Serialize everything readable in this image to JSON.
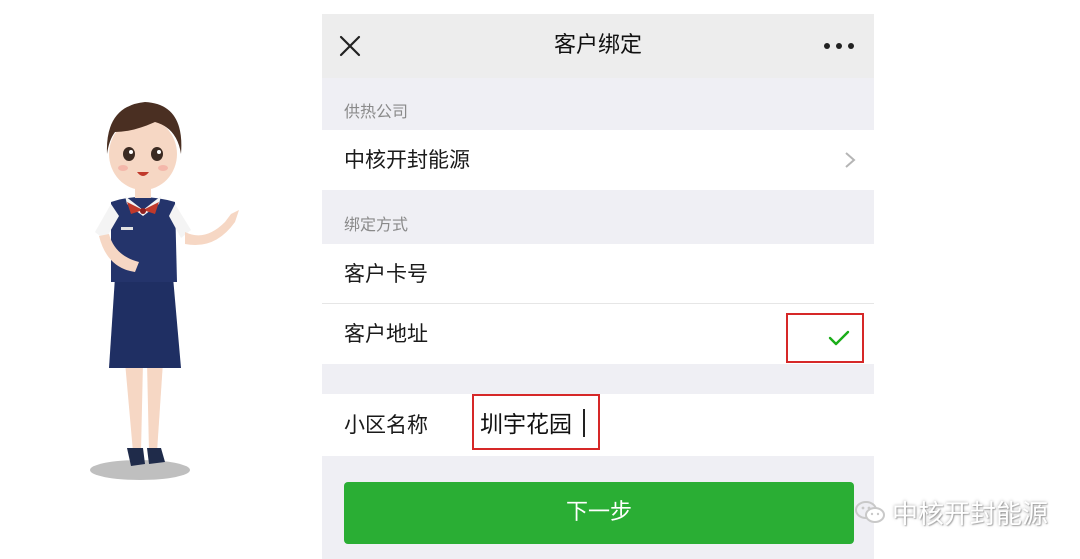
{
  "header": {
    "title": "客户绑定",
    "close_icon": "close-icon",
    "more_icon": "more-icon"
  },
  "heating_company": {
    "section_label": "供热公司",
    "value": "中核开封能源"
  },
  "bind_method": {
    "section_label": "绑定方式",
    "options": [
      {
        "label": "客户卡号",
        "selected": false
      },
      {
        "label": "客户地址",
        "selected": true
      }
    ]
  },
  "community": {
    "label": "小区名称",
    "value": "圳宇花园"
  },
  "next_button": {
    "label": "下一步"
  },
  "watermark": {
    "text": "中核开封能源",
    "icon": "wechat-icon"
  },
  "colors": {
    "accent": "#2aae34",
    "highlight": "#d62828",
    "checkmark": "#1aad19"
  }
}
